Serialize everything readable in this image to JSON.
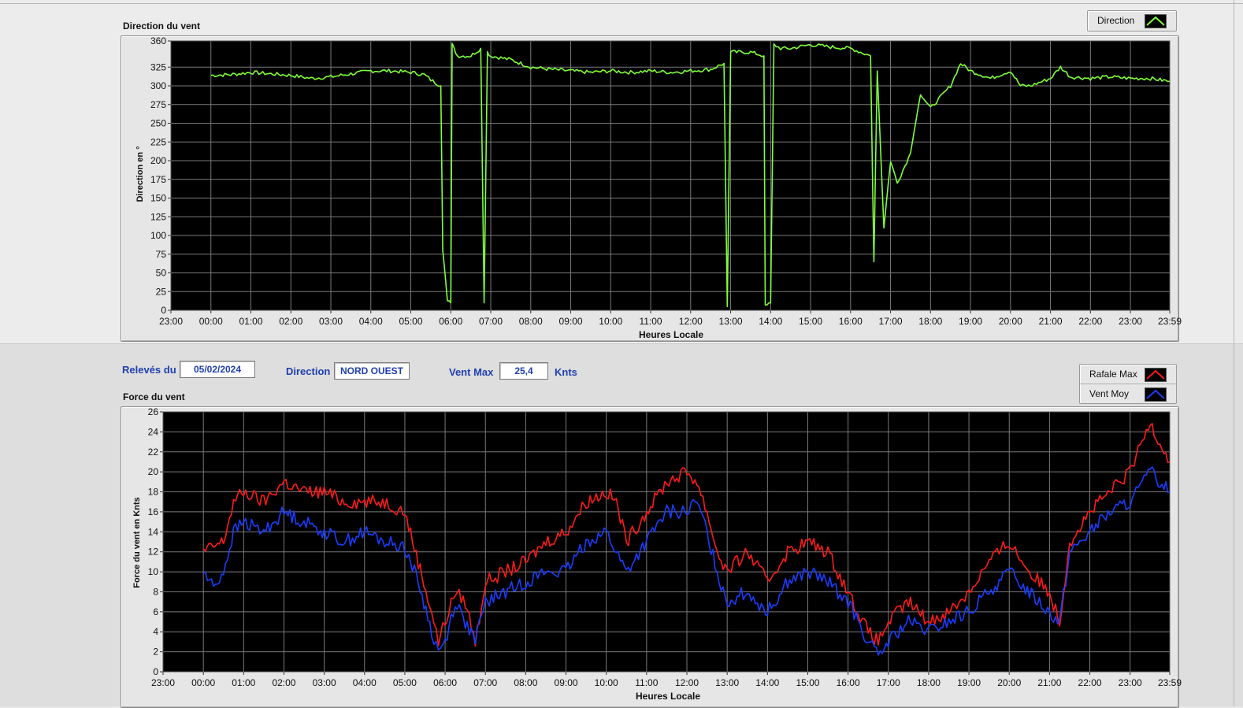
{
  "top_chart": {
    "title": "Direction du vent",
    "ylabel": "Direction en °",
    "xlabel": "Heures Locale",
    "legend": [
      {
        "label": "Direction",
        "color": "#7fff3a"
      }
    ]
  },
  "info_bar": {
    "releves_label": "Relevés du",
    "releves_value": "05/02/2024",
    "direction_label": "Direction",
    "direction_value": "NORD OUEST",
    "vent_max_label": "Vent Max",
    "vent_max_value": "25,4",
    "vent_max_unit": "Knts"
  },
  "bottom_chart": {
    "title": "Force du vent",
    "ylabel": "Force du vent en Knts",
    "xlabel": "Heures Locale",
    "legend": [
      {
        "label": "Rafale Max",
        "color": "#ff1a1a"
      },
      {
        "label": "Vent Moy",
        "color": "#1a3dff"
      }
    ]
  },
  "chart_data": [
    {
      "type": "line",
      "title": "Direction du vent",
      "xlabel": "Heures Locale",
      "ylabel": "Direction en °",
      "x_ticks": [
        "23:00",
        "00:00",
        "01:00",
        "02:00",
        "03:00",
        "04:00",
        "05:00",
        "06:00",
        "07:00",
        "08:00",
        "09:00",
        "10:00",
        "11:00",
        "12:00",
        "13:00",
        "14:00",
        "15:00",
        "16:00",
        "17:00",
        "18:00",
        "19:00",
        "20:00",
        "21:00",
        "22:00",
        "23:00",
        "23:59"
      ],
      "y_ticks": [
        0,
        25,
        50,
        75,
        100,
        125,
        150,
        175,
        200,
        225,
        250,
        275,
        300,
        325,
        360
      ],
      "ylim": [
        0,
        360
      ],
      "grid": true,
      "legend_position": "top-right",
      "series": [
        {
          "name": "Direction",
          "color": "#7fff3a",
          "points": [
            [
              "00:00",
              314
            ],
            [
              "00:30",
              315
            ],
            [
              "01:00",
              318
            ],
            [
              "01:30",
              316
            ],
            [
              "02:00",
              314
            ],
            [
              "02:30",
              310
            ],
            [
              "03:00",
              312
            ],
            [
              "03:30",
              316
            ],
            [
              "04:00",
              320
            ],
            [
              "04:30",
              320
            ],
            [
              "05:00",
              318
            ],
            [
              "05:20",
              315
            ],
            [
              "05:30",
              308
            ],
            [
              "05:45",
              300
            ],
            [
              "05:48",
              80
            ],
            [
              "05:55",
              15
            ],
            [
              "06:00",
              10
            ],
            [
              "06:02",
              355
            ],
            [
              "06:10",
              340
            ],
            [
              "06:30",
              340
            ],
            [
              "06:45",
              350
            ],
            [
              "06:50",
              10
            ],
            [
              "06:55",
              345
            ],
            [
              "07:00",
              340
            ],
            [
              "07:30",
              335
            ],
            [
              "08:00",
              325
            ],
            [
              "08:30",
              322
            ],
            [
              "09:00",
              320
            ],
            [
              "09:30",
              318
            ],
            [
              "10:00",
              320
            ],
            [
              "10:30",
              318
            ],
            [
              "11:00",
              320
            ],
            [
              "11:30",
              318
            ],
            [
              "12:00",
              320
            ],
            [
              "12:30",
              322
            ],
            [
              "12:50",
              330
            ],
            [
              "12:55",
              5
            ],
            [
              "13:00",
              345
            ],
            [
              "13:30",
              345
            ],
            [
              "13:50",
              340
            ],
            [
              "13:52",
              5
            ],
            [
              "14:00",
              10
            ],
            [
              "14:05",
              355
            ],
            [
              "14:15",
              350
            ],
            [
              "14:30",
              350
            ],
            [
              "15:00",
              355
            ],
            [
              "15:30",
              352
            ],
            [
              "16:00",
              350
            ],
            [
              "16:30",
              340
            ],
            [
              "16:35",
              65
            ],
            [
              "16:40",
              320
            ],
            [
              "16:50",
              110
            ],
            [
              "17:00",
              200
            ],
            [
              "17:10",
              170
            ],
            [
              "17:30",
              210
            ],
            [
              "17:45",
              290
            ],
            [
              "18:00",
              270
            ],
            [
              "18:30",
              300
            ],
            [
              "18:45",
              330
            ],
            [
              "19:00",
              320
            ],
            [
              "19:30",
              310
            ],
            [
              "20:00",
              320
            ],
            [
              "20:15",
              300
            ],
            [
              "20:30",
              300
            ],
            [
              "21:00",
              310
            ],
            [
              "21:15",
              325
            ],
            [
              "21:30",
              312
            ],
            [
              "22:00",
              310
            ],
            [
              "22:30",
              312
            ],
            [
              "23:00",
              310
            ],
            [
              "23:30",
              310
            ],
            [
              "23:59",
              306
            ]
          ]
        }
      ]
    },
    {
      "type": "line",
      "title": "Force du vent",
      "xlabel": "Heures Locale",
      "ylabel": "Force du vent en Knts",
      "x_ticks": [
        "23:00",
        "00:00",
        "01:00",
        "02:00",
        "03:00",
        "04:00",
        "05:00",
        "06:00",
        "07:00",
        "08:00",
        "09:00",
        "10:00",
        "11:00",
        "12:00",
        "13:00",
        "14:00",
        "15:00",
        "16:00",
        "17:00",
        "18:00",
        "19:00",
        "20:00",
        "21:00",
        "22:00",
        "23:00",
        "23:59"
      ],
      "y_ticks": [
        0,
        2,
        4,
        6,
        8,
        10,
        12,
        14,
        16,
        18,
        20,
        22,
        24,
        26
      ],
      "ylim": [
        0,
        26
      ],
      "grid": true,
      "legend_position": "top-right",
      "series": [
        {
          "name": "Rafale Max",
          "color": "#ff1a1a",
          "points": [
            [
              "00:00",
              12
            ],
            [
              "00:30",
              13
            ],
            [
              "00:45",
              17
            ],
            [
              "01:00",
              18
            ],
            [
              "01:30",
              17
            ],
            [
              "02:00",
              19
            ],
            [
              "02:30",
              18
            ],
            [
              "03:00",
              18
            ],
            [
              "03:30",
              17
            ],
            [
              "04:00",
              17
            ],
            [
              "04:30",
              17
            ],
            [
              "05:00",
              16
            ],
            [
              "05:20",
              11
            ],
            [
              "05:40",
              6
            ],
            [
              "05:50",
              3
            ],
            [
              "06:00",
              5
            ],
            [
              "06:15",
              8
            ],
            [
              "06:30",
              7
            ],
            [
              "06:45",
              3
            ],
            [
              "07:00",
              9
            ],
            [
              "07:30",
              10
            ],
            [
              "08:00",
              11
            ],
            [
              "08:30",
              13
            ],
            [
              "09:00",
              14
            ],
            [
              "09:30",
              17
            ],
            [
              "10:00",
              18
            ],
            [
              "10:15",
              17
            ],
            [
              "10:30",
              13
            ],
            [
              "11:00",
              16
            ],
            [
              "11:30",
              19
            ],
            [
              "12:00",
              20
            ],
            [
              "12:15",
              19
            ],
            [
              "12:30",
              16
            ],
            [
              "12:45",
              12
            ],
            [
              "13:00",
              10
            ],
            [
              "13:30",
              12
            ],
            [
              "14:00",
              9
            ],
            [
              "14:30",
              12
            ],
            [
              "15:00",
              13
            ],
            [
              "15:30",
              12
            ],
            [
              "16:00",
              8
            ],
            [
              "16:30",
              4
            ],
            [
              "16:45",
              3
            ],
            [
              "17:00",
              5
            ],
            [
              "17:30",
              7
            ],
            [
              "18:00",
              5
            ],
            [
              "18:30",
              6
            ],
            [
              "19:00",
              8
            ],
            [
              "19:30",
              11
            ],
            [
              "20:00",
              13
            ],
            [
              "20:30",
              10
            ],
            [
              "21:00",
              8
            ],
            [
              "21:15",
              5
            ],
            [
              "21:30",
              13
            ],
            [
              "22:00",
              16
            ],
            [
              "22:30",
              18
            ],
            [
              "23:00",
              20
            ],
            [
              "23:30",
              25
            ],
            [
              "23:59",
              21
            ]
          ]
        },
        {
          "name": "Vent Moy",
          "color": "#1a3dff",
          "points": [
            [
              "00:00",
              10
            ],
            [
              "00:15",
              8.5
            ],
            [
              "00:30",
              10
            ],
            [
              "00:45",
              14
            ],
            [
              "01:00",
              15
            ],
            [
              "01:30",
              14
            ],
            [
              "02:00",
              16
            ],
            [
              "02:30",
              15
            ],
            [
              "03:00",
              14
            ],
            [
              "03:30",
              13
            ],
            [
              "04:00",
              14
            ],
            [
              "04:30",
              13
            ],
            [
              "05:00",
              12.5
            ],
            [
              "05:20",
              9
            ],
            [
              "05:40",
              4
            ],
            [
              "05:50",
              2
            ],
            [
              "06:00",
              3
            ],
            [
              "06:15",
              7
            ],
            [
              "06:30",
              5
            ],
            [
              "06:45",
              3
            ],
            [
              "07:00",
              7
            ],
            [
              "07:30",
              8
            ],
            [
              "08:00",
              9
            ],
            [
              "08:30",
              10
            ],
            [
              "09:00",
              10
            ],
            [
              "09:30",
              13
            ],
            [
              "10:00",
              14
            ],
            [
              "10:15",
              12
            ],
            [
              "10:30",
              10
            ],
            [
              "11:00",
              13
            ],
            [
              "11:30",
              16
            ],
            [
              "12:00",
              16
            ],
            [
              "12:15",
              17
            ],
            [
              "12:30",
              14
            ],
            [
              "12:45",
              10
            ],
            [
              "13:00",
              7
            ],
            [
              "13:30",
              8
            ],
            [
              "14:00",
              6
            ],
            [
              "14:30",
              9
            ],
            [
              "15:00",
              10
            ],
            [
              "15:30",
              9
            ],
            [
              "16:00",
              7
            ],
            [
              "16:30",
              3
            ],
            [
              "16:45",
              1.5
            ],
            [
              "17:00",
              3
            ],
            [
              "17:30",
              5
            ],
            [
              "18:00",
              4
            ],
            [
              "18:30",
              5
            ],
            [
              "19:00",
              6
            ],
            [
              "19:30",
              8
            ],
            [
              "20:00",
              10
            ],
            [
              "20:30",
              8
            ],
            [
              "21:00",
              6
            ],
            [
              "21:15",
              5
            ],
            [
              "21:30",
              12
            ],
            [
              "22:00",
              14
            ],
            [
              "22:30",
              16
            ],
            [
              "23:00",
              17
            ],
            [
              "23:30",
              20
            ],
            [
              "23:59",
              18
            ]
          ]
        }
      ]
    }
  ]
}
